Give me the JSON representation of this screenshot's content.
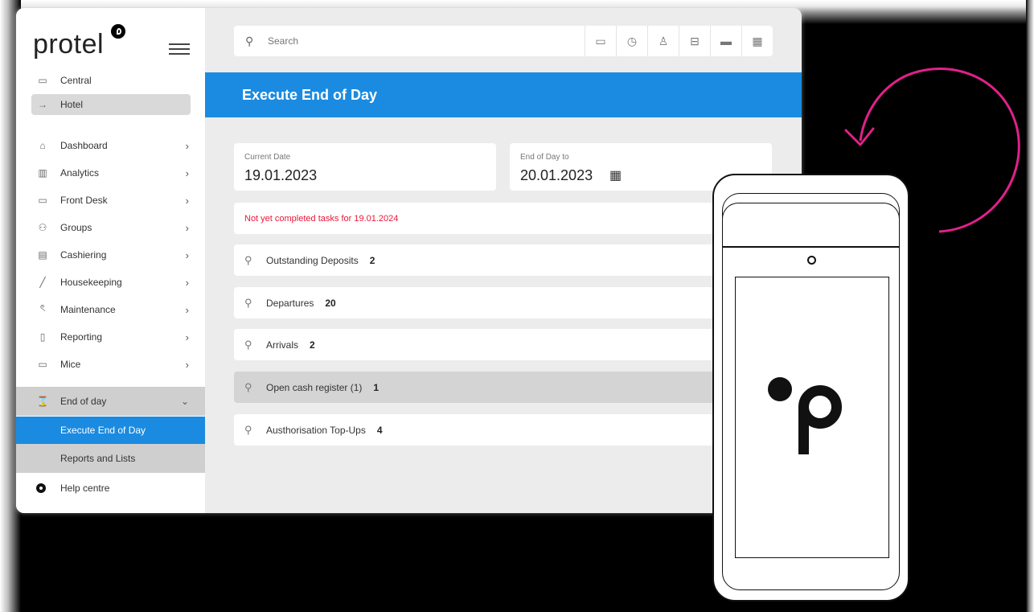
{
  "app": {
    "brand": "protel",
    "colors": {
      "accent": "#1a8be0",
      "warning": "#e8173a",
      "arrow": "#e0218a",
      "sidebar_bg": "#ffffff",
      "main_bg": "#ececec"
    }
  },
  "sidebar": {
    "scope": [
      {
        "label": "Central",
        "icon": "folder-icon",
        "selected": false
      },
      {
        "label": "Hotel",
        "icon": "arrow-right-icon",
        "selected": true
      }
    ],
    "items": [
      {
        "label": "Dashboard",
        "icon": "home-icon"
      },
      {
        "label": "Analytics",
        "icon": "bar-chart-icon"
      },
      {
        "label": "Front Desk",
        "icon": "laptop-icon"
      },
      {
        "label": "Groups",
        "icon": "groups-icon"
      },
      {
        "label": "Cashiering",
        "icon": "cash-register-icon"
      },
      {
        "label": "Housekeeping",
        "icon": "broom-icon"
      },
      {
        "label": "Maintenance",
        "icon": "wrench-icon"
      },
      {
        "label": "Reporting",
        "icon": "document-icon"
      },
      {
        "label": "Mice",
        "icon": "presentation-icon"
      }
    ],
    "end_of_day": {
      "label": "End of day",
      "icon": "hourglass-icon",
      "children": [
        "Execute End of Day",
        "Reports and Lists"
      ]
    },
    "help": "Help centre"
  },
  "search": {
    "placeholder": "Search"
  },
  "toolbar": [
    "monitor-icon",
    "clock-icon",
    "user-icon",
    "briefcase-icon",
    "card-icon",
    "calendar-grid-icon"
  ],
  "page": {
    "title": "Execute End of Day",
    "current_date_label": "Current Date",
    "current_date": "19.01.2023",
    "end_of_day_label": "End of Day to",
    "end_of_day": "20.01.2023",
    "warning": "Not yet completed tasks for 19.01.2024",
    "tasks": [
      {
        "label": "Outstanding Deposits",
        "count": "2",
        "highlight": false
      },
      {
        "label": "Departures",
        "count": "20",
        "highlight": false
      },
      {
        "label": "Arrivals",
        "count": "2",
        "highlight": false
      },
      {
        "label": "Open cash register (1)",
        "count": "1",
        "highlight": true
      },
      {
        "label": "Austhorisation Top-Ups",
        "count": "4",
        "highlight": false
      }
    ]
  }
}
